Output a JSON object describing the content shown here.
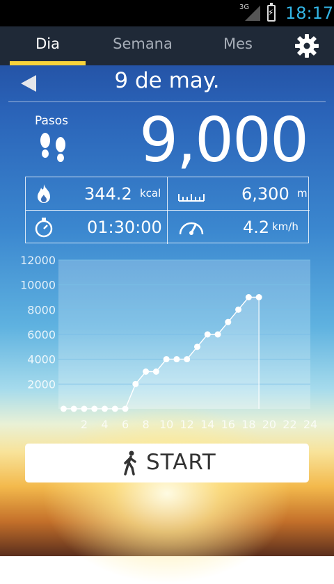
{
  "status": {
    "network": "3G",
    "time": "18:17"
  },
  "tabs": [
    {
      "label": "Dia",
      "active": true
    },
    {
      "label": "Semana",
      "active": false
    },
    {
      "label": "Mes",
      "active": false
    }
  ],
  "date": "9 de may.",
  "steps": {
    "label": "Pasos",
    "value": "9,000"
  },
  "stats": {
    "calories": {
      "value": "344.2",
      "unit": "kcal"
    },
    "distance": {
      "value": "6,300",
      "unit": "m"
    },
    "duration": {
      "value": "01:30:00"
    },
    "speed": {
      "value": "4.2",
      "unit": "km/h"
    }
  },
  "chart_data": {
    "type": "line",
    "ylim": [
      0,
      12000
    ],
    "xlim": [
      -0.5,
      24
    ],
    "yticks": [
      2000,
      4000,
      6000,
      8000,
      10000,
      12000
    ],
    "xticks": [
      2,
      4,
      6,
      8,
      10,
      12,
      14,
      16,
      18,
      20,
      22,
      24
    ],
    "x": [
      0,
      1,
      2,
      3,
      4,
      5,
      6,
      7,
      8,
      9,
      10,
      11,
      12,
      13,
      14,
      15,
      16,
      17,
      18,
      19
    ],
    "y": [
      0,
      0,
      0,
      0,
      0,
      0,
      0,
      2000,
      3000,
      3000,
      4000,
      4000,
      4000,
      5000,
      6000,
      6000,
      7000,
      8000,
      9000,
      9000
    ]
  },
  "start_button": {
    "label": "START"
  },
  "colors": {
    "accent": "#f7d33a",
    "time": "#33b5e5",
    "tabbar": "#1f2937"
  }
}
